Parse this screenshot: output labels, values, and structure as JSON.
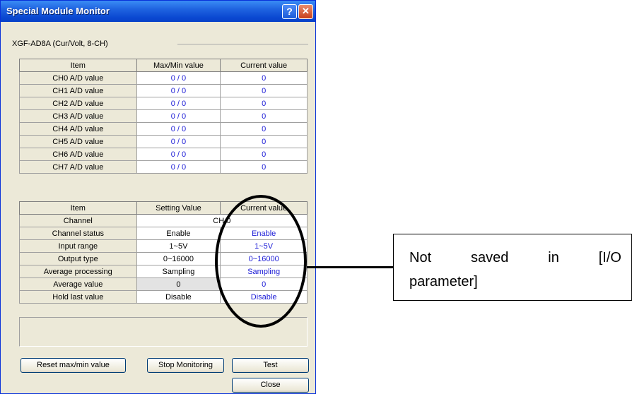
{
  "window": {
    "title": "Special Module Monitor",
    "help_glyph": "?",
    "close_glyph": "✕"
  },
  "module_label": "XGF-AD8A (Cur/Volt, 8-CH)",
  "table1": {
    "headers": [
      "Item",
      "Max/Min value",
      "Current value"
    ],
    "rows": [
      {
        "item": "CH0 A/D value",
        "maxmin": "0 / 0",
        "current": "0"
      },
      {
        "item": "CH1 A/D value",
        "maxmin": "0 / 0",
        "current": "0"
      },
      {
        "item": "CH2 A/D value",
        "maxmin": "0 / 0",
        "current": "0"
      },
      {
        "item": "CH3 A/D value",
        "maxmin": "0 / 0",
        "current": "0"
      },
      {
        "item": "CH4 A/D value",
        "maxmin": "0 / 0",
        "current": "0"
      },
      {
        "item": "CH5 A/D value",
        "maxmin": "0 / 0",
        "current": "0"
      },
      {
        "item": "CH6 A/D value",
        "maxmin": "0 / 0",
        "current": "0"
      },
      {
        "item": "CH7 A/D value",
        "maxmin": "0 / 0",
        "current": "0"
      }
    ]
  },
  "table2": {
    "headers": [
      "Item",
      "Setting Value",
      "Current value"
    ],
    "channel_label": "Channel",
    "channel_value": "CH 0",
    "rows": [
      {
        "item": "Channel status",
        "setting": "Enable",
        "current": "Enable"
      },
      {
        "item": "Input range",
        "setting": "1~5V",
        "current": "1~5V"
      },
      {
        "item": "Output type",
        "setting": "0~16000",
        "current": "0~16000"
      },
      {
        "item": "Average processing",
        "setting": "Sampling",
        "current": "Sampling"
      },
      {
        "item": "Average value",
        "setting": "0",
        "current": "0"
      },
      {
        "item": "Hold last value",
        "setting": "Disable",
        "current": "Disable"
      }
    ]
  },
  "buttons": {
    "reset": "Reset max/min value",
    "stop": "Stop Monitoring",
    "test": "Test",
    "close": "Close"
  },
  "annotation": {
    "line1_words": [
      "Not",
      "saved",
      "in",
      "[I/O"
    ],
    "line2": "parameter]"
  }
}
